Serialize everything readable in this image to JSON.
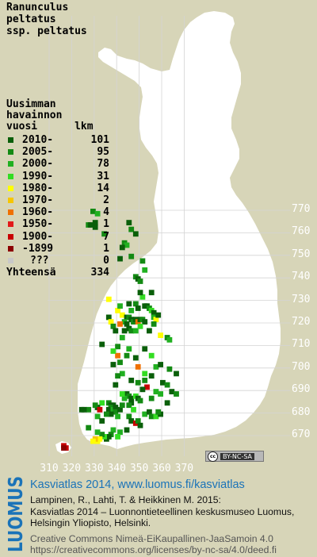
{
  "title": [
    "Ranunculus",
    "peltatus",
    "ssp. peltatus"
  ],
  "legend": {
    "header": [
      "Uusimman",
      "havainnon",
      "vuosi      lkm"
    ],
    "rows": [
      {
        "label": "2010-",
        "count": "101",
        "color": "#0a5f0a"
      },
      {
        "label": "2005-",
        "count": "95",
        "color": "#138a13"
      },
      {
        "label": "2000-",
        "count": "78",
        "color": "#20b020"
      },
      {
        "label": "1990-",
        "count": "31",
        "color": "#33dd22"
      },
      {
        "label": "1980-",
        "count": "14",
        "color": "#ffff00"
      },
      {
        "label": "1970-",
        "count": "2",
        "color": "#f6c600"
      },
      {
        "label": "1960-",
        "count": "4",
        "color": "#ef7000"
      },
      {
        "label": "1950-",
        "count": "1",
        "color": "#e21a1a"
      },
      {
        "label": "1900-",
        "count": "7",
        "color": "#c80000"
      },
      {
        "label": "-1899",
        "count": "1",
        "color": "#8c0000"
      },
      {
        "label": "???",
        "count": "0",
        "color": "#c8c8c8"
      }
    ],
    "total_label": "Yhteensä",
    "total_count": "334"
  },
  "grid": {
    "y_labels": [
      "770",
      "760",
      "750",
      "740",
      "730",
      "720",
      "710",
      "700",
      "690",
      "680",
      "670"
    ],
    "x_labels": [
      "310",
      "320",
      "330",
      "340",
      "350",
      "360",
      "370"
    ]
  },
  "cc_badge": {
    "icon": "cc",
    "text": "BY-NC-SA"
  },
  "logo_text": "LUOMUS",
  "footer": {
    "link": "Kasviatlas 2014, www.luomus.fi/kasviatlas",
    "citation": [
      "Lampinen, R., Lahti, T. & Heikkinen M. 2015:",
      "Kasviatlas 2014 – Luonnontieteellinen keskusmuseo Luomus,",
      "Helsingin Yliopisto, Helsinki."
    ],
    "license": [
      "Creative Commons Nimeä-EiKaupallinen-JaaSamoin 4.0",
      "https://creativecommons.org/licenses/by-nc-sa/4.0/deed.fi"
    ]
  },
  "observations": [
    {
      "lon": 329.5,
      "lat": 769.5,
      "period": "2005-"
    },
    {
      "lon": 331.5,
      "lat": 768.5,
      "period": "2000-"
    },
    {
      "lon": 330.5,
      "lat": 764.5,
      "period": "2010-"
    },
    {
      "lon": 327.5,
      "lat": 763.5,
      "period": "2005-"
    },
    {
      "lon": 328.5,
      "lat": 763.5,
      "period": "2010-"
    },
    {
      "lon": 330.5,
      "lat": 762.5,
      "period": "2010-"
    },
    {
      "lon": 334.5,
      "lat": 759.5,
      "period": "2005-"
    },
    {
      "lon": 345.5,
      "lat": 764.5,
      "period": "2010-"
    },
    {
      "lon": 346.5,
      "lat": 761.5,
      "period": "2005-"
    },
    {
      "lon": 348.5,
      "lat": 759.5,
      "period": "2010-"
    },
    {
      "lon": 343.5,
      "lat": 755.5,
      "period": "2005-"
    },
    {
      "lon": 344.5,
      "lat": 754.5,
      "period": "2000-"
    },
    {
      "lon": 342.5,
      "lat": 753.5,
      "period": "2010-"
    },
    {
      "lon": 346.5,
      "lat": 749.5,
      "period": "2005-"
    },
    {
      "lon": 341.5,
      "lat": 748.5,
      "period": "2010-"
    },
    {
      "lon": 351.5,
      "lat": 747.5,
      "period": "2005-"
    },
    {
      "lon": 352.5,
      "lat": 743.5,
      "period": "2000-"
    },
    {
      "lon": 348.5,
      "lat": 740.5,
      "period": "2005-"
    },
    {
      "lon": 349.5,
      "lat": 739.5,
      "period": "2010-"
    },
    {
      "lon": 350.5,
      "lat": 738.5,
      "period": "2005-"
    },
    {
      "lon": 355.5,
      "lat": 733.5,
      "period": "2010-"
    },
    {
      "lon": 351.5,
      "lat": 731.5,
      "period": "1990-"
    },
    {
      "lon": 336.5,
      "lat": 730.5,
      "period": "1980-"
    },
    {
      "lon": 345.5,
      "lat": 728.5,
      "period": "2010-"
    },
    {
      "lon": 348.5,
      "lat": 728.5,
      "period": "2005-"
    },
    {
      "lon": 352.5,
      "lat": 727.5,
      "period": "2010-"
    },
    {
      "lon": 353.5,
      "lat": 727.5,
      "period": "2010-"
    },
    {
      "lon": 354.5,
      "lat": 726.5,
      "period": "2005-"
    },
    {
      "lon": 349.5,
      "lat": 726.5,
      "period": "2010-"
    },
    {
      "lon": 355.5,
      "lat": 725.5,
      "period": "1990-"
    },
    {
      "lon": 356.5,
      "lat": 724.5,
      "period": "2010-"
    },
    {
      "lon": 340.5,
      "lat": 725.5,
      "period": "1980-"
    },
    {
      "lon": 341.5,
      "lat": 727.5,
      "period": "2000-"
    },
    {
      "lon": 342.5,
      "lat": 723.5,
      "period": "1980-"
    },
    {
      "lon": 344.5,
      "lat": 722.5,
      "period": "2010-"
    },
    {
      "lon": 345.5,
      "lat": 722.5,
      "period": "2005-"
    },
    {
      "lon": 346.5,
      "lat": 721.5,
      "period": "2010-"
    },
    {
      "lon": 347.5,
      "lat": 720.5,
      "period": "2005-"
    },
    {
      "lon": 343.5,
      "lat": 720.5,
      "period": "2000-"
    },
    {
      "lon": 344.5,
      "lat": 719.5,
      "period": "2010-"
    },
    {
      "lon": 348.5,
      "lat": 721.5,
      "period": "2010-"
    },
    {
      "lon": 349.5,
      "lat": 720.5,
      "period": "1960-"
    },
    {
      "lon": 350.5,
      "lat": 721.5,
      "period": "2010-"
    },
    {
      "lon": 351.5,
      "lat": 721.5,
      "period": "2005-"
    },
    {
      "lon": 352.5,
      "lat": 720.5,
      "period": "2010-"
    },
    {
      "lon": 356.5,
      "lat": 722.5,
      "period": "2000-"
    },
    {
      "lon": 357.5,
      "lat": 721.5,
      "period": "1980-"
    },
    {
      "lon": 358.5,
      "lat": 723.5,
      "period": "2010-"
    },
    {
      "lon": 336.5,
      "lat": 722.5,
      "period": "2010-"
    },
    {
      "lon": 337.5,
      "lat": 720.5,
      "period": "1980-"
    },
    {
      "lon": 338.5,
      "lat": 718.5,
      "period": "2005-"
    },
    {
      "lon": 345.5,
      "lat": 717.5,
      "period": "2010-"
    },
    {
      "lon": 346.5,
      "lat": 716.5,
      "period": "2005-"
    },
    {
      "lon": 348.5,
      "lat": 716.5,
      "period": "2000-"
    },
    {
      "lon": 354.5,
      "lat": 716.5,
      "period": "2010-"
    },
    {
      "lon": 359.5,
      "lat": 714.5,
      "period": "1980-"
    },
    {
      "lon": 362.5,
      "lat": 713.5,
      "period": "2005-"
    },
    {
      "lon": 363.5,
      "lat": 712.5,
      "period": "2000-"
    },
    {
      "lon": 333.5,
      "lat": 710.5,
      "period": "2010-"
    },
    {
      "lon": 340.5,
      "lat": 709.5,
      "period": "2005-"
    },
    {
      "lon": 345.5,
      "lat": 708.5,
      "period": "2000-"
    },
    {
      "lon": 352.5,
      "lat": 708.5,
      "period": "2010-"
    },
    {
      "lon": 355.5,
      "lat": 705.5,
      "period": "1990-"
    },
    {
      "lon": 340.5,
      "lat": 705.5,
      "period": "1960-"
    },
    {
      "lon": 344.5,
      "lat": 705.5,
      "period": "2005-"
    },
    {
      "lon": 348.5,
      "lat": 704.5,
      "period": "2010-"
    },
    {
      "lon": 338.5,
      "lat": 701.5,
      "period": "2010-"
    },
    {
      "lon": 341.5,
      "lat": 702.5,
      "period": "2005-"
    },
    {
      "lon": 357.5,
      "lat": 700.5,
      "period": "2000-"
    },
    {
      "lon": 359.5,
      "lat": 701.5,
      "period": "2010-"
    },
    {
      "lon": 363.5,
      "lat": 699.5,
      "period": "2005-"
    },
    {
      "lon": 366.5,
      "lat": 697.5,
      "period": "2010-"
    },
    {
      "lon": 342.5,
      "lat": 697.5,
      "period": "2000-"
    },
    {
      "lon": 352.5,
      "lat": 697.5,
      "period": "1990-"
    },
    {
      "lon": 355.5,
      "lat": 696.5,
      "period": "2010-"
    },
    {
      "lon": 346.5,
      "lat": 694.5,
      "period": "2010-"
    },
    {
      "lon": 349.5,
      "lat": 693.5,
      "period": "2005-"
    },
    {
      "lon": 360.5,
      "lat": 693.5,
      "period": "2010-"
    },
    {
      "lon": 362.5,
      "lat": 692.5,
      "period": "2005-"
    },
    {
      "lon": 339.5,
      "lat": 692.5,
      "period": "2010-"
    },
    {
      "lon": 353.5,
      "lat": 691.5,
      "period": "1900-"
    },
    {
      "lon": 357.5,
      "lat": 689.5,
      "period": "2000-"
    },
    {
      "lon": 364.5,
      "lat": 689.5,
      "period": "2010-"
    },
    {
      "lon": 366.5,
      "lat": 688.5,
      "period": "2005-"
    },
    {
      "lon": 344.5,
      "lat": 688.5,
      "period": "2010-"
    },
    {
      "lon": 345.5,
      "lat": 687.5,
      "period": "2005-"
    },
    {
      "lon": 346.5,
      "lat": 686.5,
      "period": "2010-"
    },
    {
      "lon": 343.5,
      "lat": 686.5,
      "period": "2000-"
    },
    {
      "lon": 348.5,
      "lat": 687.5,
      "period": "1990-"
    },
    {
      "lon": 349.5,
      "lat": 686.5,
      "period": "2010-"
    },
    {
      "lon": 350.5,
      "lat": 685.5,
      "period": "2005-"
    },
    {
      "lon": 346.5,
      "lat": 684.5,
      "period": "2010-"
    },
    {
      "lon": 345.5,
      "lat": 683.5,
      "period": "2005-"
    },
    {
      "lon": 336.5,
      "lat": 684.5,
      "period": "2005-"
    },
    {
      "lon": 337.5,
      "lat": 683.5,
      "period": "2010-"
    },
    {
      "lon": 338.5,
      "lat": 683.5,
      "period": "2010-"
    },
    {
      "lon": 337.5,
      "lat": 682.5,
      "period": "2005-"
    },
    {
      "lon": 336.5,
      "lat": 681.5,
      "period": "2010-"
    },
    {
      "lon": 338.5,
      "lat": 681.5,
      "period": "2000-"
    },
    {
      "lon": 339.5,
      "lat": 682.5,
      "period": "2010-"
    },
    {
      "lon": 339.5,
      "lat": 680.5,
      "period": "2005-"
    },
    {
      "lon": 337.5,
      "lat": 679.5,
      "period": "2010-"
    },
    {
      "lon": 335.5,
      "lat": 679.5,
      "period": "2005-"
    },
    {
      "lon": 340.5,
      "lat": 678.5,
      "period": "2000-"
    },
    {
      "lon": 341.5,
      "lat": 681.5,
      "period": "2010-"
    },
    {
      "lon": 342.5,
      "lat": 683.5,
      "period": "2005-"
    },
    {
      "lon": 333.5,
      "lat": 684.5,
      "period": "1990-"
    },
    {
      "lon": 331.5,
      "lat": 682.5,
      "period": "2010-"
    },
    {
      "lon": 330.5,
      "lat": 683.5,
      "period": "2005-"
    },
    {
      "lon": 332.5,
      "lat": 681.5,
      "period": "1900-"
    },
    {
      "lon": 327.5,
      "lat": 681.5,
      "period": "2005-"
    },
    {
      "lon": 325.5,
      "lat": 681.5,
      "period": "2010-"
    },
    {
      "lon": 324.5,
      "lat": 681.5,
      "period": "2010-"
    },
    {
      "lon": 331.5,
      "lat": 678.5,
      "period": "2000-"
    },
    {
      "lon": 333.5,
      "lat": 676.5,
      "period": "2010-"
    },
    {
      "lon": 345.5,
      "lat": 678.5,
      "period": "2005-"
    },
    {
      "lon": 346.5,
      "lat": 676.5,
      "period": "2010-"
    },
    {
      "lon": 348.5,
      "lat": 675.5,
      "period": "1900-"
    },
    {
      "lon": 349.5,
      "lat": 676.5,
      "period": "2005-"
    },
    {
      "lon": 350.5,
      "lat": 674.5,
      "period": "2010-"
    },
    {
      "lon": 352.5,
      "lat": 679.5,
      "period": "2000-"
    },
    {
      "lon": 354.5,
      "lat": 680.5,
      "period": "2010-"
    },
    {
      "lon": 355.5,
      "lat": 678.5,
      "period": "2005-"
    },
    {
      "lon": 357.5,
      "lat": 678.5,
      "period": "1990-"
    },
    {
      "lon": 359.5,
      "lat": 679.5,
      "period": "2010-"
    },
    {
      "lon": 358.5,
      "lat": 680.5,
      "period": "2005-"
    },
    {
      "lon": 347.5,
      "lat": 681.5,
      "period": "1990-"
    },
    {
      "lon": 344.5,
      "lat": 672.5,
      "period": "2010-"
    },
    {
      "lon": 341.5,
      "lat": 671.5,
      "period": "2000-"
    },
    {
      "lon": 340.5,
      "lat": 669.5,
      "period": "1990-"
    },
    {
      "lon": 338.5,
      "lat": 672.5,
      "period": "2000-"
    },
    {
      "lon": 337.5,
      "lat": 670.5,
      "period": "2005-"
    },
    {
      "lon": 336.5,
      "lat": 669.5,
      "period": "2010-"
    },
    {
      "lon": 335.5,
      "lat": 668.5,
      "period": "2010-"
    },
    {
      "lon": 334.5,
      "lat": 669.5,
      "period": "1990-"
    },
    {
      "lon": 333.5,
      "lat": 670.5,
      "period": "2005-"
    },
    {
      "lon": 332.5,
      "lat": 668.5,
      "period": "1980-"
    },
    {
      "lon": 331.5,
      "lat": 667.5,
      "period": "1980-"
    },
    {
      "lon": 330.5,
      "lat": 668.5,
      "period": "1970-"
    },
    {
      "lon": 331.5,
      "lat": 671.5,
      "period": "2000-"
    },
    {
      "lon": 329.5,
      "lat": 667.5,
      "period": "1980-"
    },
    {
      "lon": 327.5,
      "lat": 673.5,
      "period": "2005-"
    },
    {
      "lon": 316.5,
      "lat": 665.5,
      "period": "1900-"
    },
    {
      "lon": 317.5,
      "lat": 664.5,
      "period": "1900-"
    },
    {
      "lon": 316.5,
      "lat": 664.5,
      "period": "-1899"
    },
    {
      "lon": 342.5,
      "lat": 688.5,
      "period": "1990-"
    },
    {
      "lon": 355.5,
      "lat": 686.5,
      "period": "2005-"
    },
    {
      "lon": 362.5,
      "lat": 684.5,
      "period": "2010-"
    },
    {
      "lon": 359.5,
      "lat": 688.5,
      "period": "2000-"
    },
    {
      "lon": 352.5,
      "lat": 694.5,
      "period": "2005-"
    },
    {
      "lon": 351.5,
      "lat": 690.5,
      "period": "2010-"
    },
    {
      "lon": 340.5,
      "lat": 696.5,
      "period": "2005-"
    },
    {
      "lon": 349.5,
      "lat": 700.5,
      "period": "1960-"
    },
    {
      "lon": 338.5,
      "lat": 707.5,
      "period": "1990-"
    },
    {
      "lon": 342.5,
      "lat": 713.5,
      "period": "2000-"
    },
    {
      "lon": 341.5,
      "lat": 719.5,
      "period": "1960-"
    },
    {
      "lon": 339.5,
      "lat": 716.5,
      "period": "2010-"
    },
    {
      "lon": 346.5,
      "lat": 725.5,
      "period": "2000-"
    },
    {
      "lon": 350.5,
      "lat": 733.5,
      "period": "2010-"
    },
    {
      "lon": 356.5,
      "lat": 719.5,
      "period": "2005-"
    },
    {
      "lon": 343.5,
      "lat": 716.5,
      "period": "2010-"
    },
    {
      "lon": 350.5,
      "lat": 718.5,
      "period": "1990-"
    }
  ]
}
